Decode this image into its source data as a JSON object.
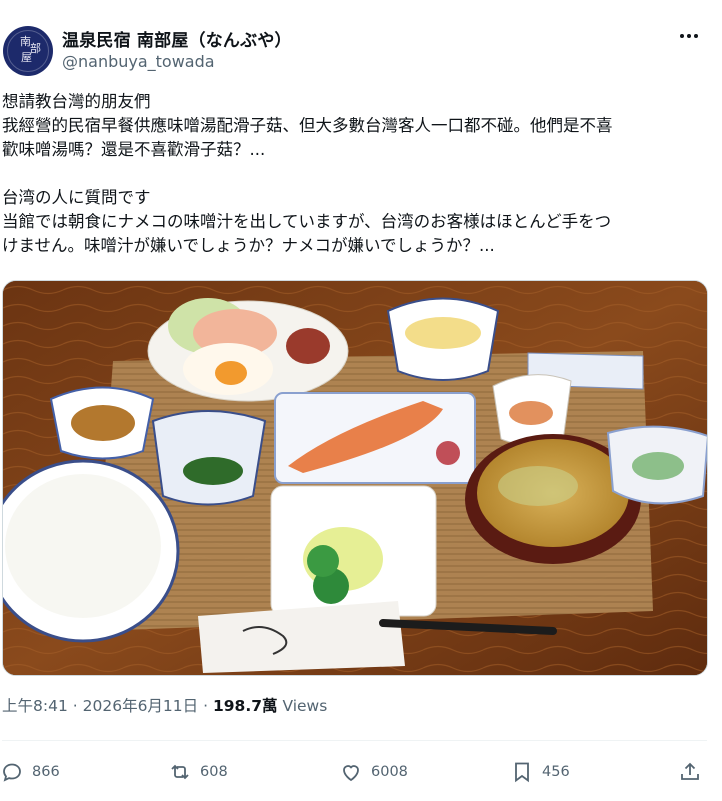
{
  "author": {
    "display_name": "温泉民宿 南部屋（なんぶや）",
    "handle": "@nanbuya_towada",
    "avatar_icon": "inn-logo-icon"
  },
  "post": {
    "lines_zh": [
      "想請教台灣的朋友們",
      "我經營的民宿早餐供應味噌湯配滑子菇、但大多數台灣客人一口都不碰。他們是不喜",
      "歡味噌湯嗎？還是不喜歡滑子菇？..."
    ],
    "lines_ja": [
      "台湾の人に質問です",
      "当館では朝食にナメコの味噌汁を出していますが、台湾のお客様はほとんど手をつ",
      "けません。味噌汁が嫌いでしょうか？ナメコが嫌いでしょうか？..."
    ]
  },
  "media": {
    "description_icon": "breakfast-photo"
  },
  "meta": {
    "time": "上午8:41",
    "date": "2026年6月11日",
    "separator": "·",
    "views_count": "198.7萬",
    "views_label": "Views"
  },
  "actions": {
    "replies": "866",
    "reposts": "608",
    "likes": "6008",
    "bookmarks": "456"
  },
  "colors": {
    "text": "#0f1419",
    "secondary": "#536471",
    "divider": "#eff3f4",
    "avatar_bg": "#1d2a6b"
  }
}
